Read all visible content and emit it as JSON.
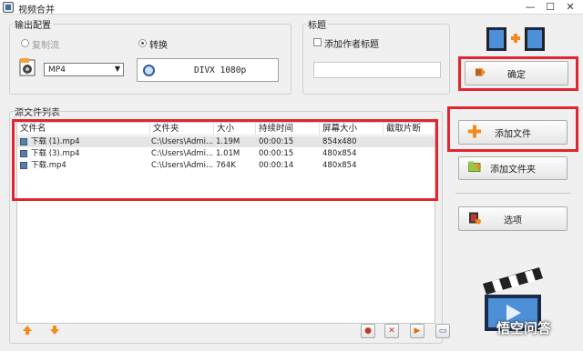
{
  "window": {
    "title": "视频合并",
    "minimize": "—",
    "maximize": "☐",
    "close": "✕"
  },
  "output_config": {
    "title": "输出配置",
    "copy_label": "复制流",
    "convert_label": "转换",
    "format_value": "MP4",
    "codec_text": "DIVX 1080p"
  },
  "title_group": {
    "title": "标题",
    "add_author_title_label": "添加作者标题",
    "title_value": ""
  },
  "buttons": {
    "confirm": "确定",
    "add_file": "添加文件",
    "add_folder": "添加文件夹",
    "options": "选项"
  },
  "source_list": {
    "title": "源文件列表",
    "columns": [
      "文件名",
      "文件夹",
      "大小",
      "持续时间",
      "屏幕大小",
      "截取片断"
    ],
    "rows": [
      {
        "name": "下载 (1).mp4",
        "folder": "C:\\Users\\Admi...",
        "size": "1.19M",
        "duration": "00:00:15",
        "screen": "854x480",
        "clip": ""
      },
      {
        "name": "下载 (3).mp4",
        "folder": "C:\\Users\\Admi...",
        "size": "1.01M",
        "duration": "00:00:15",
        "screen": "480x854",
        "clip": ""
      },
      {
        "name": "下载.mp4",
        "folder": "C:\\Users\\Admi...",
        "size": "764K",
        "duration": "00:00:14",
        "screen": "480x854",
        "clip": ""
      }
    ]
  },
  "watermark": {
    "text": "悟空问答"
  },
  "colors": {
    "highlight_red": "#e0262e",
    "plus_orange": "#f28a1c"
  }
}
